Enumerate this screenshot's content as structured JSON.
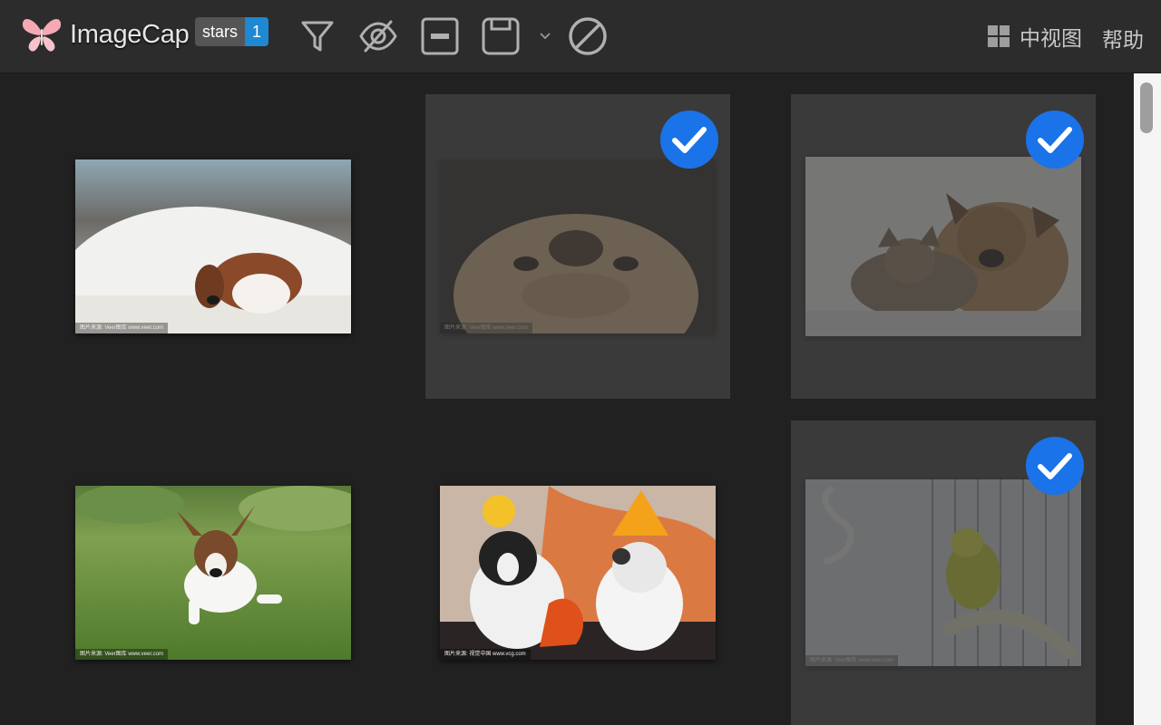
{
  "app": {
    "title": "ImageCap",
    "badge_label": "stars",
    "badge_count": "1",
    "logo_icon": "butterfly-logo-icon"
  },
  "toolbar": {
    "tools": [
      "filter-icon",
      "eye-off-icon",
      "minus-box-icon",
      "save-icon",
      "chevron-down-icon",
      "block-icon"
    ],
    "view_label": "中视图",
    "view_icon": "grid-icon",
    "help_label": "帮助"
  },
  "colors": {
    "accent": "#1e88d2",
    "check": "#1a73e8",
    "toolbar": "#2c2c2c",
    "background": "#212121",
    "selected_card": "#3a3a3a"
  },
  "gallery": {
    "items": [
      {
        "subject": "puppy-under-blanket",
        "selected": false,
        "watermark": "图片来源: Veer图库 www.veer.com"
      },
      {
        "subject": "labrador-closeup",
        "selected": true,
        "watermark": "图片来源: Veer图库 www.veer.com"
      },
      {
        "subject": "cat-and-puppy",
        "selected": true,
        "watermark": ""
      },
      {
        "subject": "puppy-running-on-grass",
        "selected": false,
        "watermark": "图片来源: Veer图库 www.veer.com"
      },
      {
        "subject": "two-bulldogs-halloween",
        "selected": false,
        "watermark": "图片来源: 视觉中国 www.vcg.com"
      },
      {
        "subject": "budgie-in-cage",
        "selected": true,
        "watermark": "图片来源: Veer图库 www.veer.com"
      }
    ]
  }
}
